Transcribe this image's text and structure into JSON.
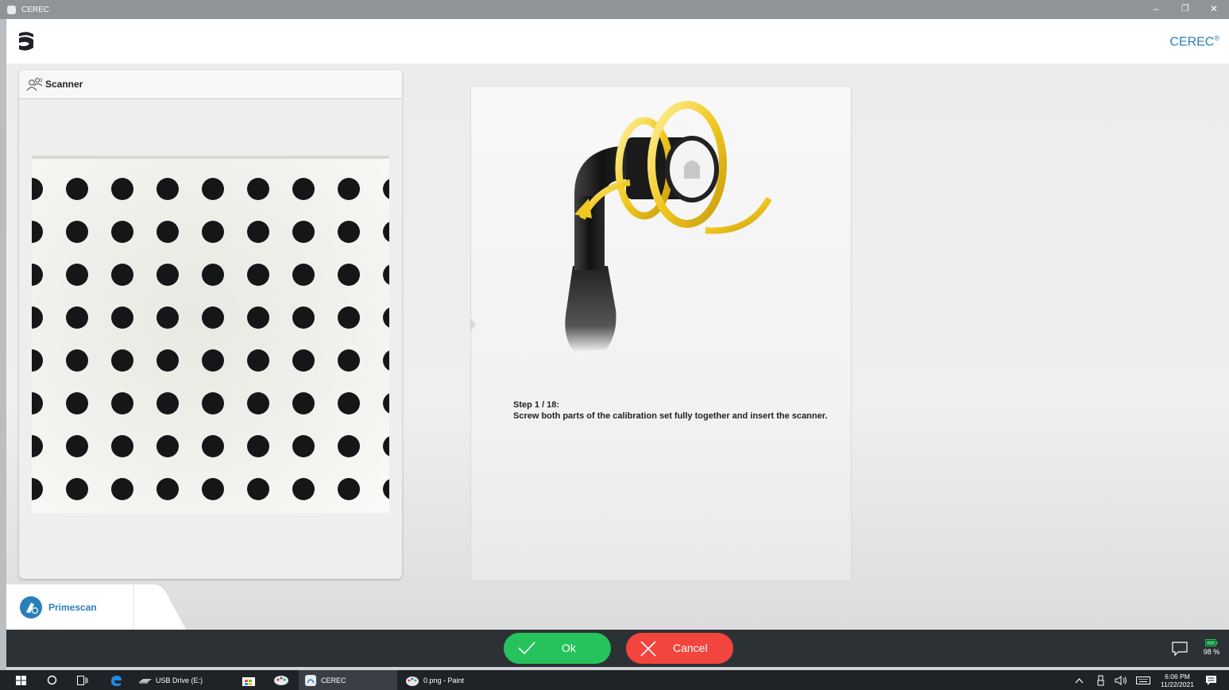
{
  "window": {
    "title": "CEREC",
    "controls": [
      "–",
      "❐",
      "✕"
    ]
  },
  "header": {
    "brand": "CEREC",
    "brand_mark": "®"
  },
  "scanner_panel": {
    "title": "Scanner"
  },
  "instructions": {
    "step_label": "Step 1 / 18:",
    "step_text": "Screw both parts of the calibration set fully together and insert the scanner."
  },
  "device_tab": {
    "label": "Primescan"
  },
  "actions": {
    "ok_label": "Ok",
    "cancel_label": "Cancel",
    "battery": "98 %"
  },
  "taskbar": {
    "items": [
      {
        "label": "USB Drive (E:)"
      },
      {
        "label": "CEREC"
      },
      {
        "label": "0.png - Paint"
      }
    ],
    "time": "6:06 PM",
    "date": "11/22/2021"
  },
  "colors": {
    "accent": "#2a7fb9",
    "ok": "#26c35c",
    "cancel": "#f2453d"
  }
}
